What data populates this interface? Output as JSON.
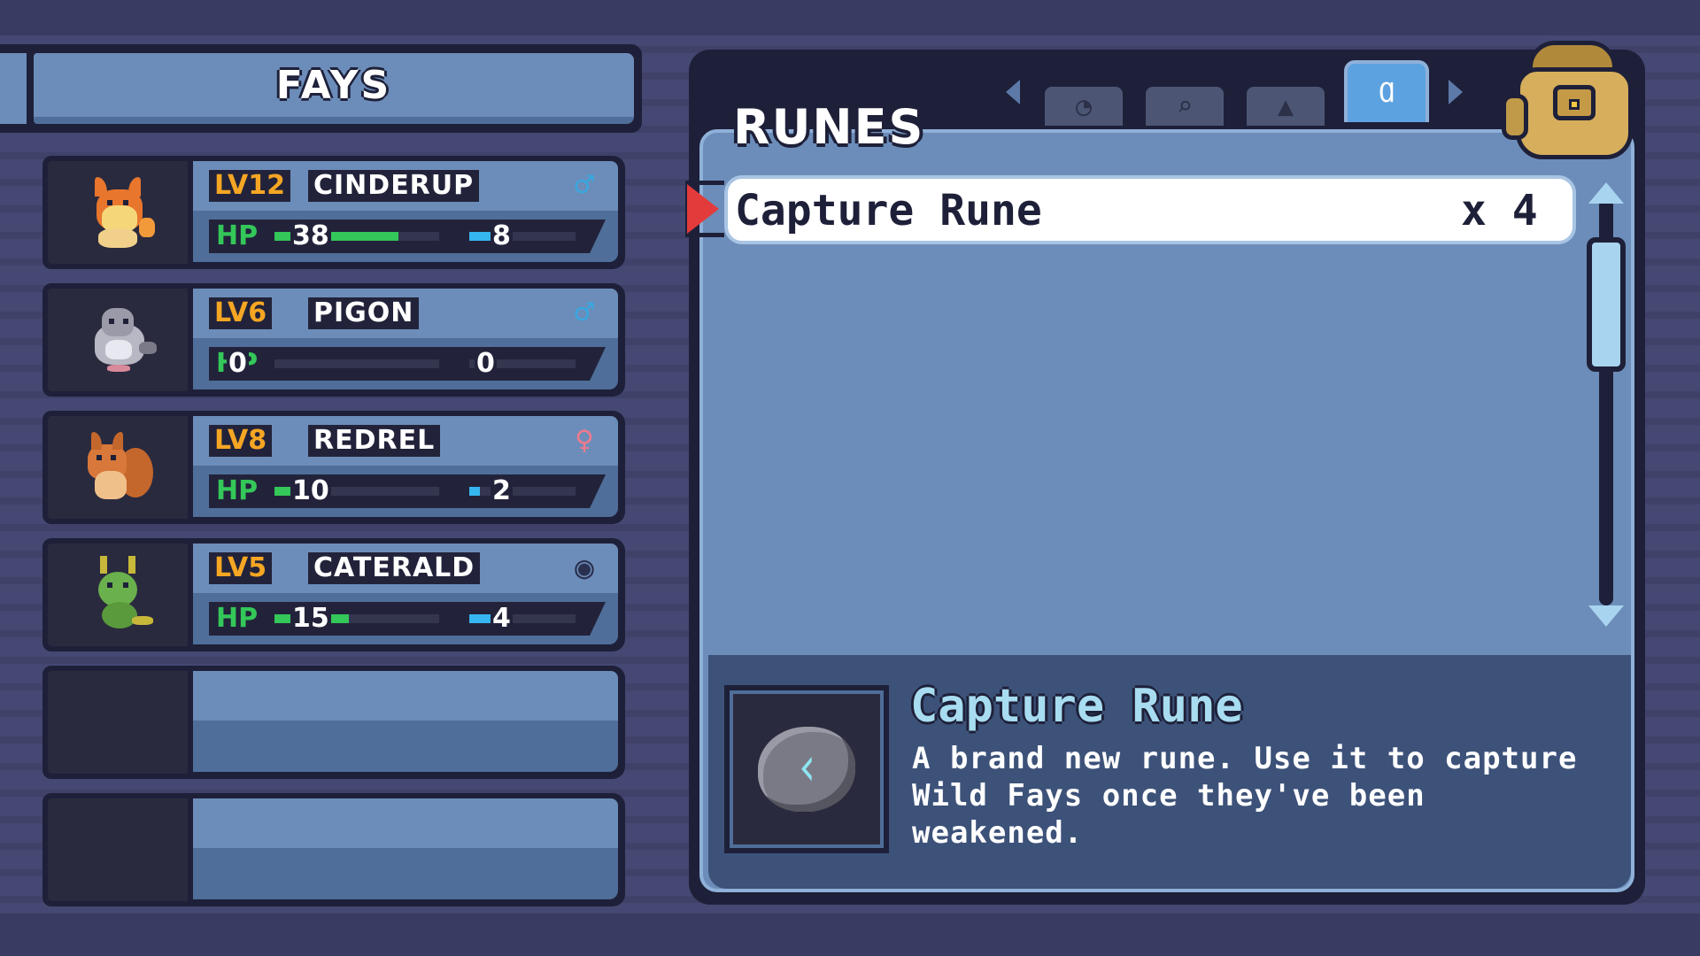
{
  "fays_panel": {
    "title": "FAYS",
    "slots": [
      {
        "level": "LV12",
        "name": "CINDERUP",
        "gender_icon": "male-icon",
        "gender_symbol": "♂",
        "hp_label": "HP",
        "hp": "38",
        "hp_ratio": 0.75,
        "mp": "8",
        "mp_ratio": 0.25,
        "sprite": "fox-fire"
      },
      {
        "level": "LV6",
        "name": "PIGON",
        "gender_icon": "male-icon",
        "gender_symbol": "♂",
        "hp_label": "HP",
        "hp": "0",
        "hp_ratio": 0,
        "mp": "0",
        "mp_ratio": 0,
        "sprite": "pigeon"
      },
      {
        "level": "LV8",
        "name": "REDREL",
        "gender_icon": "female-icon",
        "gender_symbol": "♀",
        "hp_label": "HP",
        "hp": "10",
        "hp_ratio": 0.25,
        "mp": "2",
        "mp_ratio": 0.1,
        "sprite": "squirrel"
      },
      {
        "level": "LV5",
        "name": "CATERALD",
        "gender_icon": "genderless-icon",
        "gender_symbol": "◉",
        "hp_label": "HP",
        "hp": "15",
        "hp_ratio": 0.45,
        "mp": "4",
        "mp_ratio": 0.3,
        "sprite": "caterpillar"
      }
    ]
  },
  "runes_panel": {
    "title": "RUNES",
    "tabs": [
      {
        "icon": "helmet-icon",
        "symbol": "◔"
      },
      {
        "icon": "magnifier-icon",
        "symbol": "⌕"
      },
      {
        "icon": "stone-icon",
        "symbol": "▲"
      },
      {
        "icon": "rune-icon",
        "symbol": "Ɑ",
        "active": true
      }
    ],
    "items": [
      {
        "name": "Capture Rune",
        "quantity": "x 4",
        "selected": true
      }
    ],
    "description": {
      "title": "Capture Rune",
      "text": "A brand new rune. Use it to capture Wild Fays once they've been weakened.",
      "icon_glyph": "ᚲ"
    }
  },
  "colors": {
    "background": "#454872",
    "panel_dark": "#1e2039",
    "panel_blue": "#6c8db9",
    "hp_green": "#34c759",
    "mp_blue": "#35b6f0",
    "level_orange": "#f5a623",
    "cursor_red": "#e33b3b"
  }
}
